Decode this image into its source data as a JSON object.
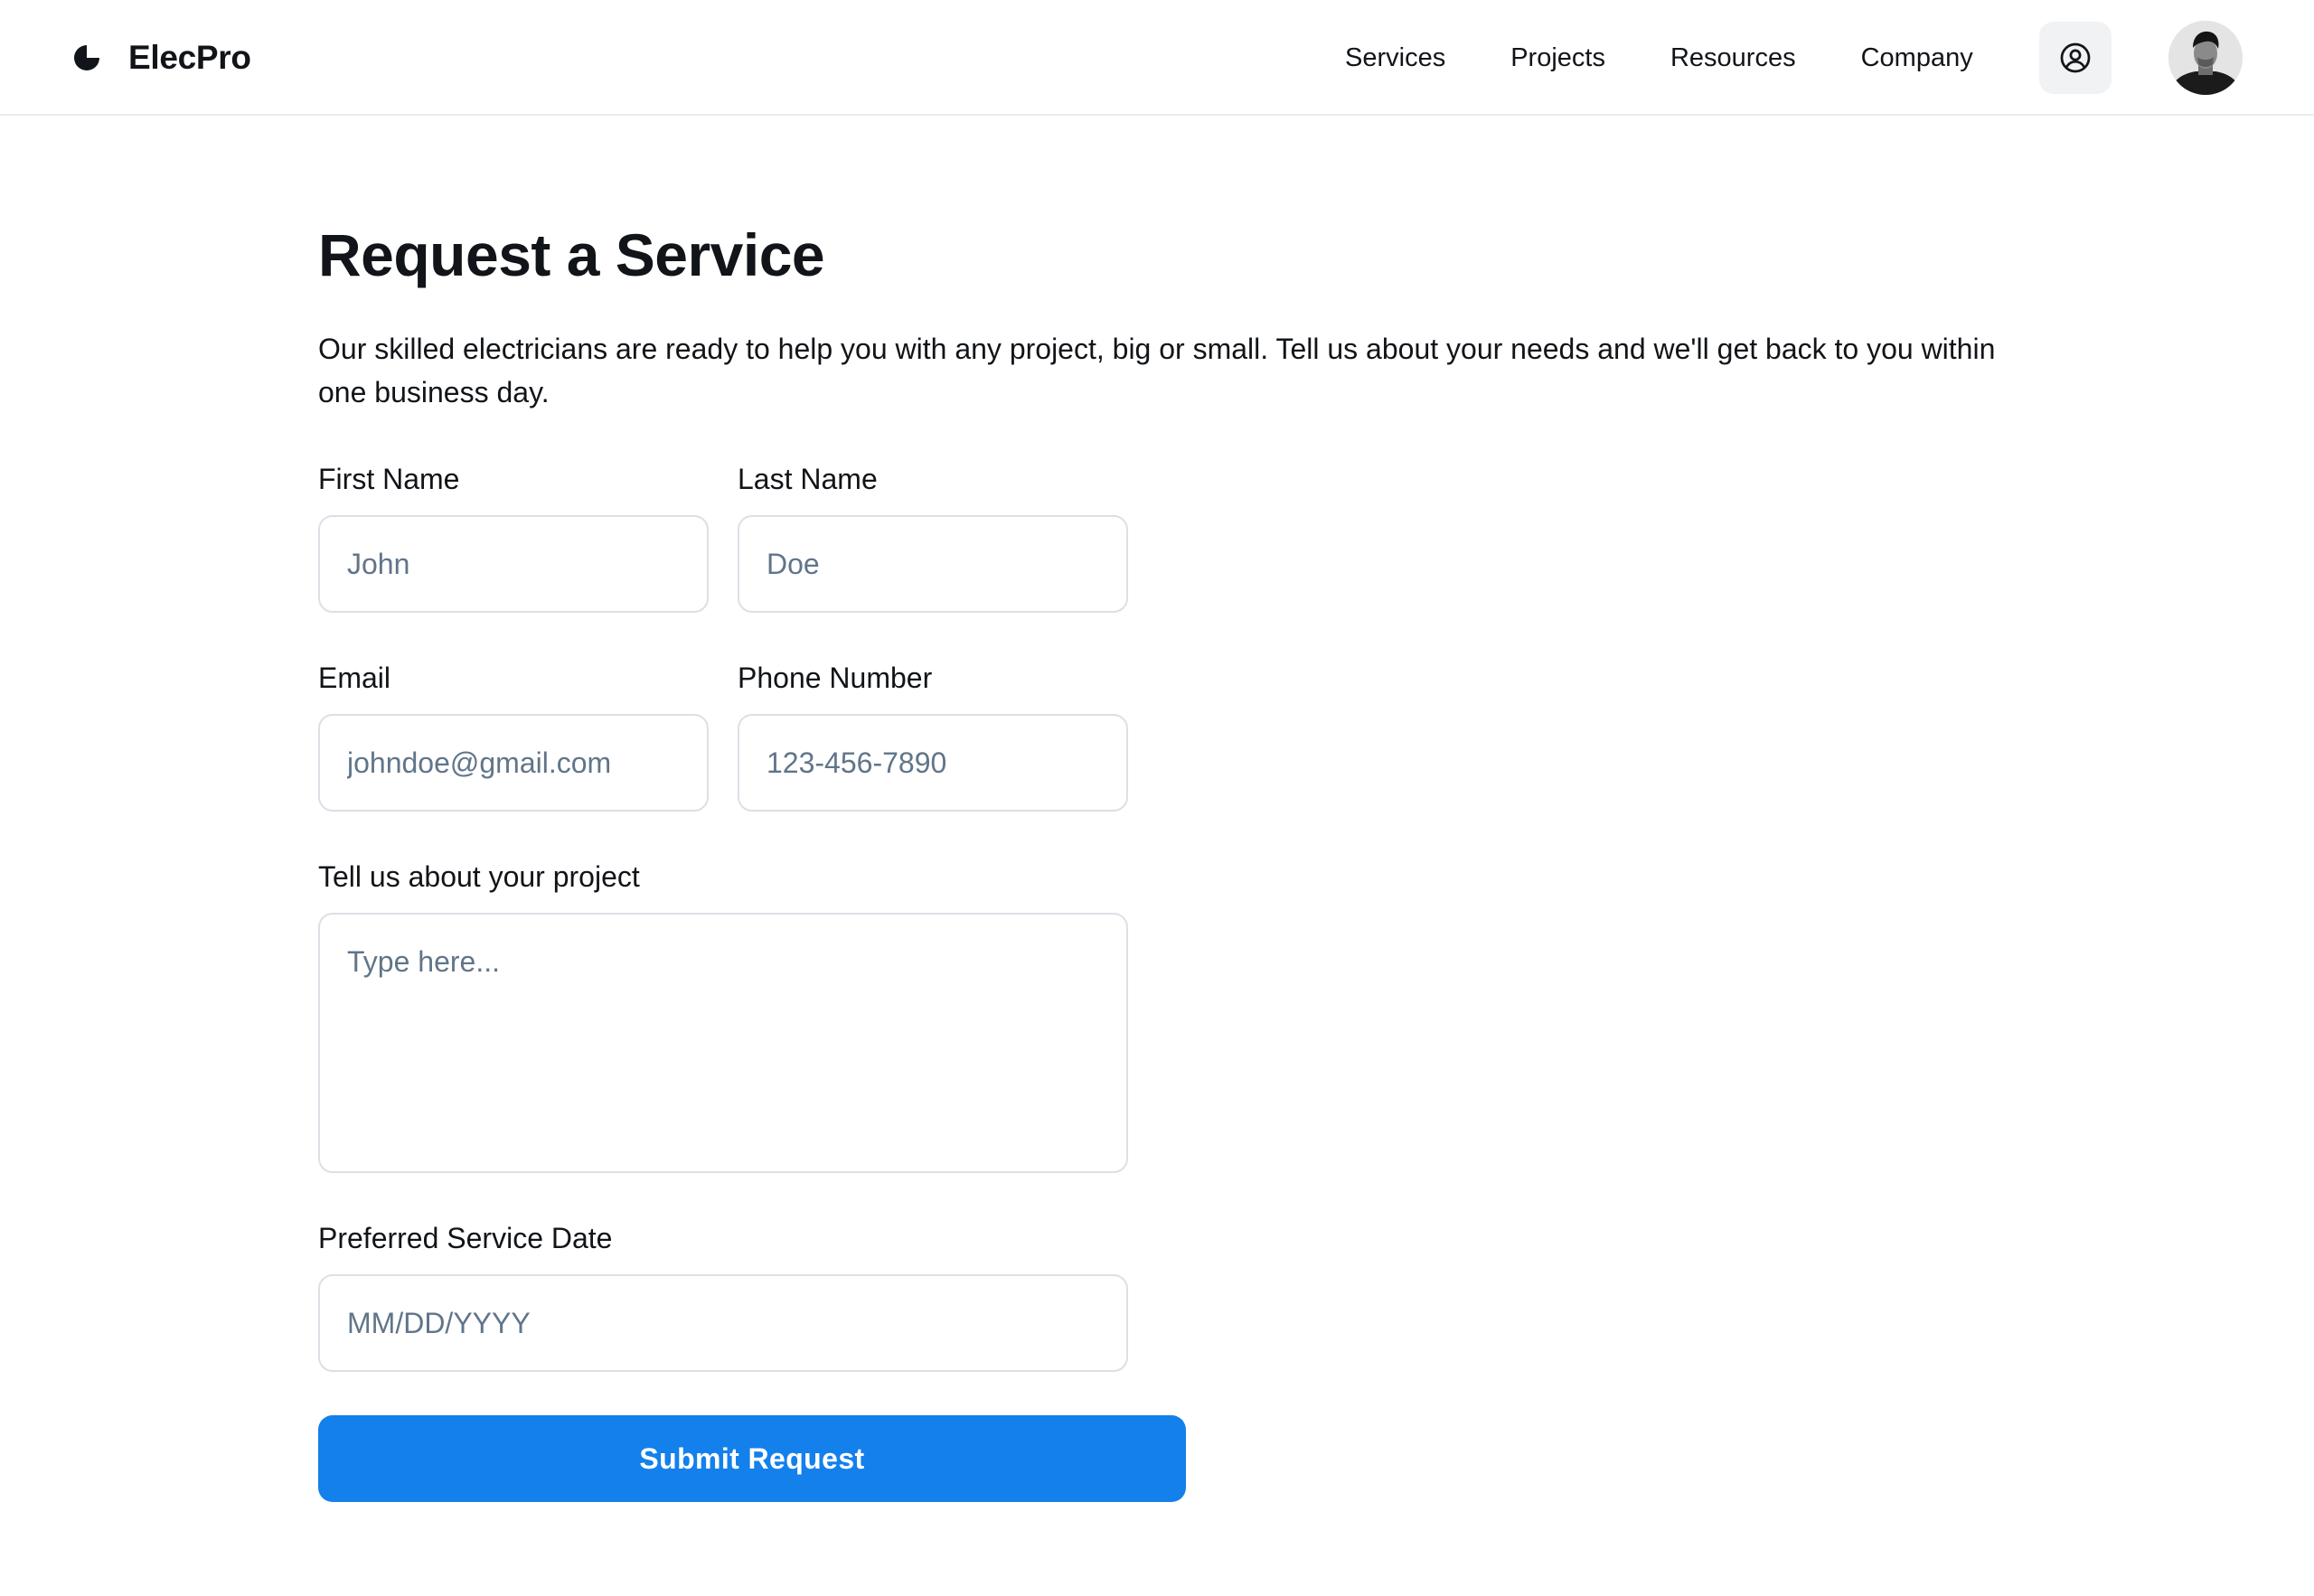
{
  "brand": {
    "name": "ElecPro",
    "logo_icon": "brand-logo-icon"
  },
  "nav": {
    "items": [
      "Services",
      "Projects",
      "Resources",
      "Company"
    ]
  },
  "header": {
    "account_icon": "user-circle-icon",
    "avatar": "user-avatar-photo"
  },
  "form": {
    "title": "Request a Service",
    "intro": "Our skilled electricians are ready to help you with any project, big or small. Tell us about your needs and we'll get back to you within one business day.",
    "first_name": {
      "label": "First Name",
      "placeholder": "John",
      "value": ""
    },
    "last_name": {
      "label": "Last Name",
      "placeholder": "Doe",
      "value": ""
    },
    "email": {
      "label": "Email",
      "placeholder": "johndoe@gmail.com",
      "value": ""
    },
    "phone": {
      "label": "Phone Number",
      "placeholder": "123-456-7890",
      "value": ""
    },
    "project": {
      "label": "Tell us about your project",
      "placeholder": "Type here...",
      "value": ""
    },
    "date": {
      "label": "Preferred Service Date",
      "placeholder": "MM/DD/YYYY",
      "value": ""
    },
    "submit_label": "Submit Request"
  },
  "colors": {
    "primary": "#1380ec",
    "text": "#111418",
    "placeholder": "#617589",
    "border": "#dbe0e6",
    "icon_button_bg": "#f0f2f4"
  }
}
